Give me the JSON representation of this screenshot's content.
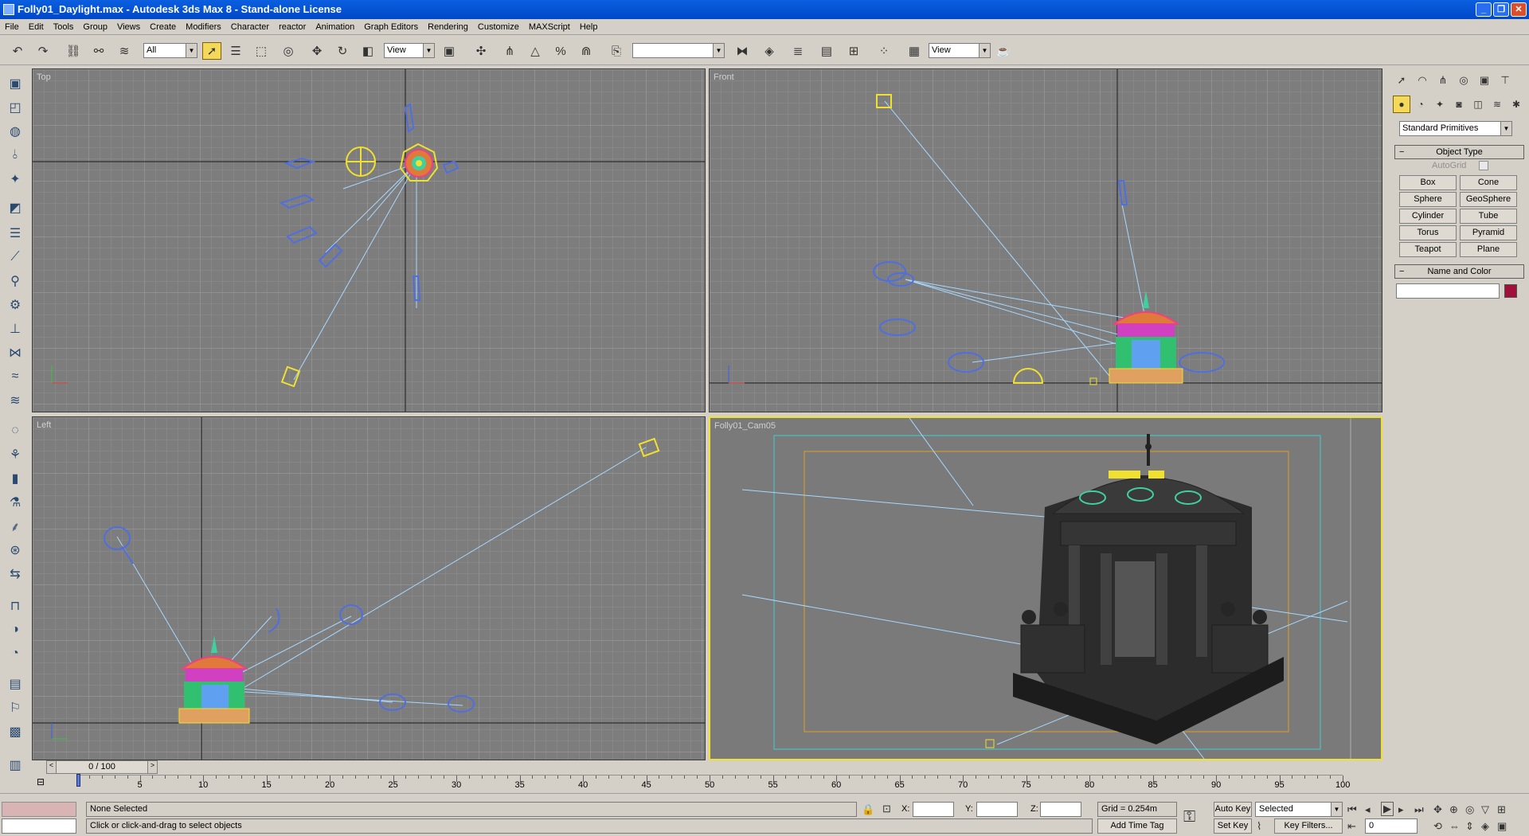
{
  "window": {
    "title": "Folly01_Daylight.max - Autodesk 3ds Max 8  - Stand-alone License"
  },
  "menu": [
    "File",
    "Edit",
    "Tools",
    "Group",
    "Views",
    "Create",
    "Modifiers",
    "Character",
    "reactor",
    "Animation",
    "Graph Editors",
    "Rendering",
    "Customize",
    "MAXScript",
    "Help"
  ],
  "toolbar": {
    "selection_filter": "All",
    "ref_coord": "View",
    "named_selection": "",
    "render_view": "View"
  },
  "viewports": {
    "top": "Top",
    "front": "Front",
    "left": "Left",
    "camera": "Folly01_Cam05"
  },
  "command_panel": {
    "category": "Standard Primitives",
    "object_type_title": "Object Type",
    "autogrid": "AutoGrid",
    "buttons": [
      "Box",
      "Cone",
      "Sphere",
      "GeoSphere",
      "Cylinder",
      "Tube",
      "Torus",
      "Pyramid",
      "Teapot",
      "Plane"
    ],
    "name_color_title": "Name and Color",
    "name_value": "",
    "object_color": "#a0103a"
  },
  "timeline": {
    "frame": "0 / 100",
    "ticks": [
      "5",
      "10",
      "15",
      "20",
      "25",
      "30",
      "35",
      "40",
      "45",
      "50",
      "55",
      "60",
      "65",
      "70",
      "75",
      "80",
      "85",
      "90",
      "95",
      "100"
    ]
  },
  "status": {
    "selection": "None Selected",
    "prompt": "Click or click-and-drag to select objects",
    "x_label": "X:",
    "y_label": "Y:",
    "z_label": "Z:",
    "grid": "Grid = 0.254m",
    "add_time_tag": "Add Time Tag",
    "auto_key": "Auto Key",
    "set_key": "Set Key",
    "key_mode": "Selected",
    "key_filters": "Key Filters...",
    "current_frame": "0"
  },
  "colors": {
    "viewport_bg": "#7d7d7d",
    "active_border": "#f0e030",
    "light_lines": "#a8d8ff",
    "titlebar": "#0a5fe0"
  }
}
